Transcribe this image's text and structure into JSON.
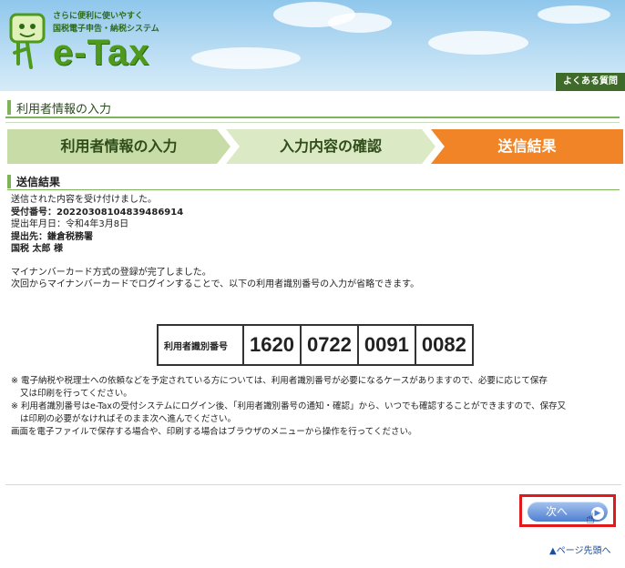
{
  "header": {
    "tagline1": "さらに便利に使いやすく",
    "tagline2": "国税電子申告・納税システム",
    "logo_text": "e-Tax",
    "faq_link": "よくある質問"
  },
  "page_title": "利用者情報の入力",
  "steps": [
    {
      "label": "利用者情報の入力",
      "state": "done"
    },
    {
      "label": "入力内容の確認",
      "state": "done"
    },
    {
      "label": "送信結果",
      "state": "current"
    }
  ],
  "section_title": "送信結果",
  "result": {
    "line1": "送信された内容を受け付けました。",
    "receipt_no": "受付番号：20220308104839486914",
    "date": "提出年月日：令和4年3月8日",
    "office": "提出先：鎌倉税務署",
    "name": "国税 太郎 様",
    "msg1": "マイナンバーカード方式の登録が完了しました。",
    "msg2": "次回からマイナンバーカードでログインすることで、以下の利用者識別番号の入力が省略できます。"
  },
  "user_id": {
    "label": "利用者識別番号",
    "parts": [
      "1620",
      "0722",
      "0091",
      "0082"
    ]
  },
  "notes": {
    "n1a": "※ 電子納税や税理士への依頼などを予定されている方については、利用者識別番号が必要になるケースがありますので、必要に応じて保存",
    "n1b": "又は印刷を行ってください。",
    "n2a": "※ 利用者識別番号はe-Taxの受付システムにログイン後、「利用者識別番号の通知・確認」から、いつでも確認することができますので、保存又",
    "n2b": "は印刷の必要がなければそのまま次へ進んでください。",
    "n3": "画面を電子ファイルで保存する場合や、印刷する場合はブラウザのメニューから操作を行ってください。"
  },
  "next_button": "次へ",
  "page_top_link": "ページ先頭へ",
  "colors": {
    "accent_green": "#7fb35a",
    "current_step": "#f08427",
    "highlight": "#e01a1a"
  }
}
